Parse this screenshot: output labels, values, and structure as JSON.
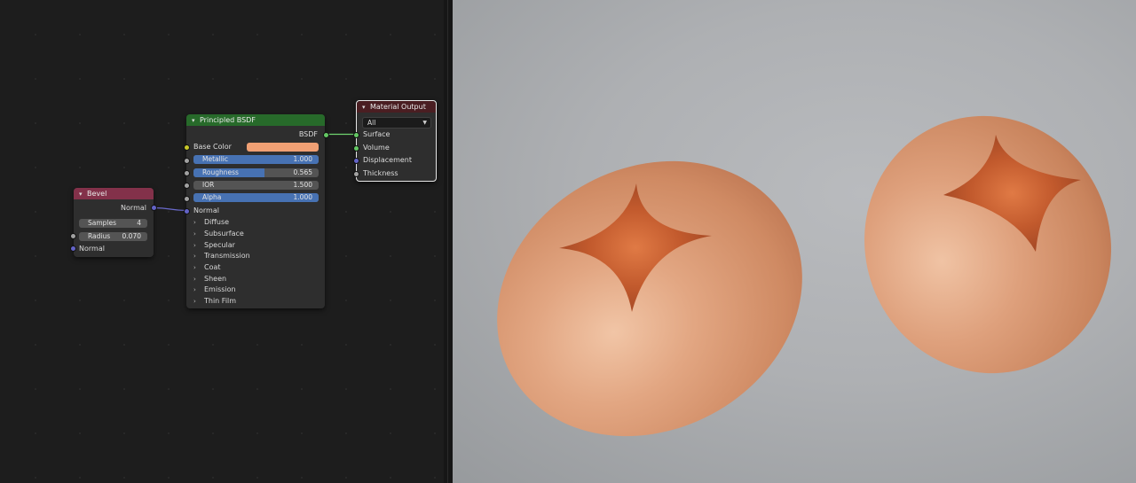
{
  "colors": {
    "editor_bg": "#1d1d1d",
    "node_bg": "#2e2e2e",
    "bevel_header": "#83314a",
    "bsdf_header": "#276a2a",
    "output_header": "#4a1e22",
    "base_color_swatch": "#f0a074",
    "slider_fill": "#4772b3",
    "socket_gray": "#a1a1a1",
    "socket_yellow": "#c7c729",
    "socket_purple": "#6363c7",
    "socket_green": "#63c763"
  },
  "icons": {
    "collapse": "chevron-down-icon",
    "panel": "chevron-right-icon",
    "dropdown": "dropdown-arrow-icon"
  },
  "bevel": {
    "title": "Bevel",
    "output_normal": "Normal",
    "samples_label": "Samples",
    "samples_value": "4",
    "radius_label": "Radius",
    "radius_value": "0.070",
    "input_normal": "Normal"
  },
  "bsdf": {
    "title": "Principled BSDF",
    "output_bsdf": "BSDF",
    "base_color_label": "Base Color",
    "metallic": {
      "label": "Metallic",
      "value": "1.000",
      "fraction": 1.0
    },
    "roughness": {
      "label": "Roughness",
      "value": "0.565",
      "fraction": 0.565
    },
    "ior": {
      "label": "IOR",
      "value": "1.500",
      "fraction": 0
    },
    "alpha": {
      "label": "Alpha",
      "value": "1.000",
      "fraction": 1.0
    },
    "normal_label": "Normal",
    "panels": [
      "Diffuse",
      "Subsurface",
      "Specular",
      "Transmission",
      "Coat",
      "Sheen",
      "Emission",
      "Thin Film"
    ]
  },
  "material_output": {
    "title": "Material Output",
    "target": "All",
    "inputs": [
      "Surface",
      "Volume",
      "Displacement",
      "Thickness"
    ]
  }
}
